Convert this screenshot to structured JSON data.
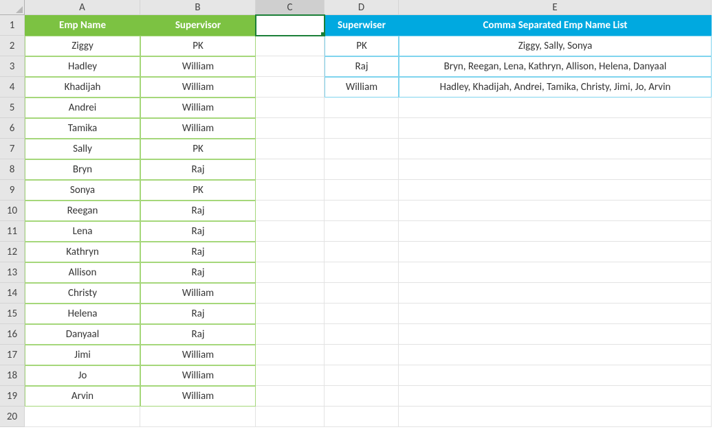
{
  "columns": [
    "A",
    "B",
    "C",
    "D",
    "E"
  ],
  "rowCount": 20,
  "activeCell": "C1",
  "greenHeaders": {
    "emp": "Emp Name",
    "sup": "Supervisor"
  },
  "blueHeaders": {
    "sup": "Superwiser",
    "list": "Comma Separated Emp Name List"
  },
  "empRows": [
    {
      "name": "Ziggy",
      "sup": "PK"
    },
    {
      "name": "Hadley",
      "sup": "William"
    },
    {
      "name": "Khadijah",
      "sup": "William"
    },
    {
      "name": "Andrei",
      "sup": "William"
    },
    {
      "name": "Tamika",
      "sup": "William"
    },
    {
      "name": "Sally",
      "sup": "PK"
    },
    {
      "name": "Bryn",
      "sup": "Raj"
    },
    {
      "name": "Sonya",
      "sup": "PK"
    },
    {
      "name": "Reegan",
      "sup": "Raj"
    },
    {
      "name": "Lena",
      "sup": "Raj"
    },
    {
      "name": "Kathryn",
      "sup": "Raj"
    },
    {
      "name": "Allison",
      "sup": "Raj"
    },
    {
      "name": "Christy",
      "sup": "William"
    },
    {
      "name": "Helena",
      "sup": "Raj"
    },
    {
      "name": "Danyaal",
      "sup": "Raj"
    },
    {
      "name": "Jimi",
      "sup": "William"
    },
    {
      "name": "Jo",
      "sup": "William"
    },
    {
      "name": "Arvin",
      "sup": "William"
    }
  ],
  "summaryRows": [
    {
      "sup": "PK",
      "list": "Ziggy, Sally, Sonya"
    },
    {
      "sup": "Raj",
      "list": "Bryn, Reegan, Lena, Kathryn, Allison, Helena, Danyaal"
    },
    {
      "sup": "William",
      "list": "Hadley, Khadijah, Andrei, Tamika, Christy, Jimi, Jo, Arvin"
    }
  ]
}
